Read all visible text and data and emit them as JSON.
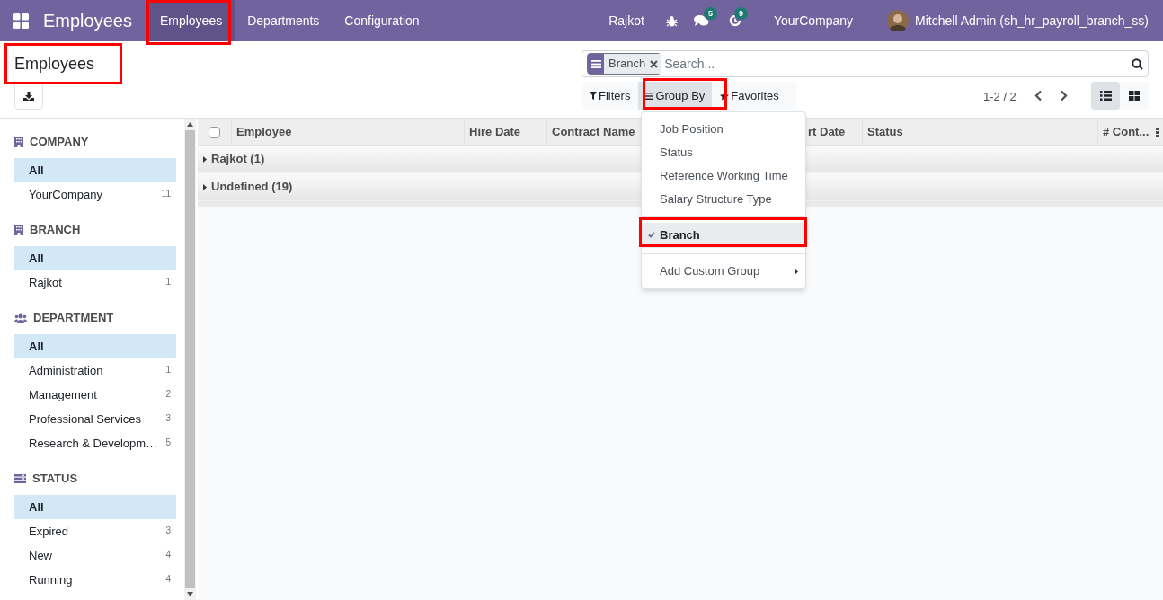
{
  "app": {
    "title": "Employees"
  },
  "menu": [
    {
      "label": "Employees",
      "selected": true
    },
    {
      "label": "Departments",
      "selected": false
    },
    {
      "label": "Configuration",
      "selected": false
    }
  ],
  "systray": {
    "branch": "Rajkot",
    "messages_count": "5",
    "activities_count": "9",
    "company": "YourCompany",
    "user": "Mitchell Admin (sh_hr_payroll_branch_ss)"
  },
  "breadcrumb": "Employees",
  "search": {
    "facets": [
      {
        "label": "Branch"
      }
    ],
    "placeholder": "Search..."
  },
  "search_buttons": [
    {
      "kind": "filter",
      "label": "Filters",
      "selected": false
    },
    {
      "kind": "group",
      "label": "Group By",
      "selected": true
    },
    {
      "kind": "favorite",
      "label": "Favorites",
      "selected": false
    }
  ],
  "pager": "1-2 / 2",
  "views": [
    {
      "kind": "list",
      "selected": true
    },
    {
      "kind": "kanban",
      "selected": false
    }
  ],
  "sidebar": [
    {
      "kind": "building",
      "title": "COMPANY",
      "items": [
        {
          "label": "All",
          "selected": true
        },
        {
          "label": "YourCompany",
          "count": "11",
          "selected": false
        }
      ]
    },
    {
      "kind": "building",
      "title": "BRANCH",
      "items": [
        {
          "label": "All",
          "selected": true
        },
        {
          "label": "Rajkot",
          "count": "1",
          "selected": false
        }
      ]
    },
    {
      "kind": "people",
      "title": "DEPARTMENT",
      "items": [
        {
          "label": "All",
          "selected": true
        },
        {
          "label": "Administration",
          "count": "1",
          "selected": false
        },
        {
          "label": "Management",
          "count": "2",
          "selected": false
        },
        {
          "label": "Professional Services",
          "count": "3",
          "selected": false
        },
        {
          "label": "Research & Developm…",
          "count": "5",
          "selected": false
        }
      ]
    },
    {
      "kind": "list",
      "title": "STATUS",
      "items": [
        {
          "label": "All",
          "selected": true
        },
        {
          "label": "Expired",
          "count": "3",
          "selected": false
        },
        {
          "label": "New",
          "count": "4",
          "selected": false
        },
        {
          "label": "Running",
          "count": "4",
          "selected": false
        }
      ]
    }
  ],
  "table": {
    "select_all": {
      "checked": false
    },
    "columns": [
      "Employee",
      "Hire Date",
      "Contract Name",
      "rt Date",
      "Status",
      "# Cont..."
    ],
    "groups": [
      {
        "label": "Rajkot (1)",
        "expanded": false
      },
      {
        "label": "Undefined (19)",
        "expanded": false
      }
    ]
  },
  "group_by_menu": {
    "sections": [
      {
        "items": [
          {
            "label": "Job Position",
            "checked": false
          },
          {
            "label": "Status",
            "checked": false
          },
          {
            "label": "Reference Working Time",
            "checked": false
          },
          {
            "label": "Salary Structure Type",
            "checked": false
          }
        ]
      },
      {
        "items": [
          {
            "label": "Branch",
            "checked": true
          }
        ]
      }
    ],
    "custom": "Add Custom Group"
  }
}
